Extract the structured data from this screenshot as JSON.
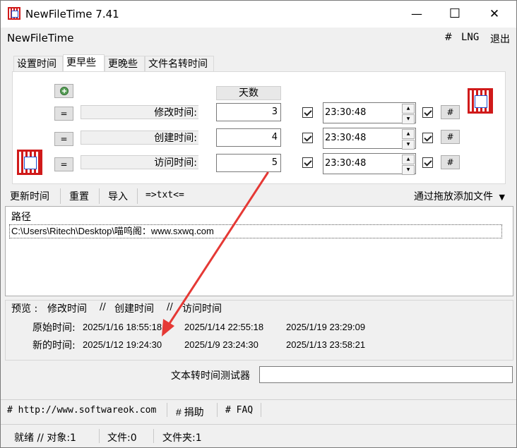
{
  "window": {
    "title": "NewFileTime 7.41",
    "minimize": "—",
    "maximize": "☐",
    "close": "✕"
  },
  "menubar": {
    "app_label": "NewFileTime",
    "hash": "#",
    "lng": "LNG",
    "exit": "退出"
  },
  "tabs": [
    "设置时间",
    "更早些",
    "更晚些",
    "文件名转时间"
  ],
  "days_header": "天数",
  "rows": [
    {
      "eq": "=",
      "label": "修改时间:",
      "days": "3",
      "time": "23:30:48",
      "hash": "#"
    },
    {
      "eq": "=",
      "label": "创建时间:",
      "days": "4",
      "time": "23:30:48",
      "hash": "#"
    },
    {
      "eq": "=",
      "label": "访问时间:",
      "days": "5",
      "time": "23:30:48",
      "hash": "#"
    }
  ],
  "toolbar": {
    "update": "更新时间",
    "reset": "重置",
    "import": "导入",
    "txt": "=>txt<=",
    "drag_add": "通过拖放添加文件"
  },
  "list": {
    "header": "路径",
    "item": "C:\\Users\\Ritech\\Desktop\\喵呜阁：www.sxwq.com"
  },
  "preview": {
    "label": "预览 :",
    "col1": "修改时间",
    "sep1": "//",
    "col2": "创建时间",
    "sep2": "//",
    "col3": "访问时间",
    "orig_label": "原始时间:",
    "orig": [
      "2025/1/16 18:55:18",
      "2025/1/14 22:55:18",
      "2025/1/19 23:29:09"
    ],
    "new_label": "新的时间:",
    "new": [
      "2025/1/12 19:24:30",
      "2025/1/9 23:24:30",
      "2025/1/13 23:58:21"
    ]
  },
  "tester": {
    "label": "文本转时间测试器",
    "value": ""
  },
  "footer": {
    "url": "# http://www.softwareok.com",
    "donate": "# 捐助",
    "faq": "# FAQ"
  },
  "status": {
    "ready": "就绪 // 对象:1",
    "files": "文件:0",
    "folders": "文件夹:1"
  },
  "colors": {
    "arrow": "#e53935",
    "icon_red": "#d01a1a"
  }
}
